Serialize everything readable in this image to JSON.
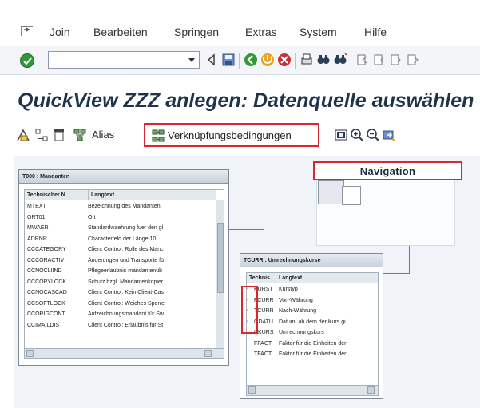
{
  "menu": {
    "items": [
      "Join",
      "Bearbeiten",
      "Springen",
      "Extras",
      "System",
      "Hilfe"
    ]
  },
  "toolbar": {
    "command_field": ""
  },
  "page": {
    "title": "QuickView ZZZ anlegen: Datenquelle auswählen"
  },
  "app_toolbar": {
    "alias_label": "Alias",
    "join_conditions_label": "Verknüpfungsbedingungen"
  },
  "navigation": {
    "title": "Navigation"
  },
  "t000": {
    "title": "T000 : Mandanten",
    "col_field": "Technischer N",
    "col_text": "Langtext",
    "rows": [
      {
        "f": "MTEXT",
        "d": "Bezeichnung des Mandanten"
      },
      {
        "f": "ORT01",
        "d": "Ort"
      },
      {
        "f": "MWAER",
        "d": "Standardwaehrung fuer den gl"
      },
      {
        "f": "ADRNR",
        "d": "Characterfeld der Länge 10"
      },
      {
        "f": "CCCATEGORY",
        "d": "Client Control: Rolle des Manc"
      },
      {
        "f": "CCCORACTIV",
        "d": "Änderungen und Transporte fü"
      },
      {
        "f": "CCNOCLIIND",
        "d": "Pflegeerlaubnis mandantenüb"
      },
      {
        "f": "CCCOPYLOCK",
        "d": "Schutz bzgl. Mandantenkopier"
      },
      {
        "f": "CCNOCASCAD",
        "d": "Client Control: Kein Client-Cas"
      },
      {
        "f": "CCSOFTLOCK",
        "d": "Client Control: Weiches Sperre"
      },
      {
        "f": "CCORIGCONT",
        "d": "Aufzeichnungsmandant für Sw"
      },
      {
        "f": "CCIMAILDIS",
        "d": "Client Control: Erlaubnis für St"
      }
    ]
  },
  "tcurr": {
    "title": "TCURR : Umrechnungskurse",
    "col_field": "Technis",
    "col_text": "Langtext",
    "rows": [
      {
        "f": "KURST",
        "d": "Kurstyp"
      },
      {
        "f": "FCURR",
        "d": "Von-Währung"
      },
      {
        "f": "TCURR",
        "d": "Nach-Währung"
      },
      {
        "f": "GDATU",
        "d": "Datum, ab dem der Kurs gi"
      },
      {
        "f": "UKURS",
        "d": "Umrechnungskurs"
      },
      {
        "f": "FFACT",
        "d": "Faktor für die Einheiten der"
      },
      {
        "f": "TFACT",
        "d": "Faktor für die Einheiten der"
      }
    ]
  },
  "colors": {
    "highlight": "#d9262f",
    "title": "#1f3449",
    "ok": "#2f9a3a"
  },
  "icons": {
    "menu": "menu-arrow-icon",
    "ok": "checkmark-icon",
    "back": "back-icon",
    "save": "save-icon",
    "exit": "exit-icon",
    "cancel": "cancel-icon",
    "print": "print-icon",
    "find": "find-icon",
    "find_next": "find-next-icon"
  }
}
